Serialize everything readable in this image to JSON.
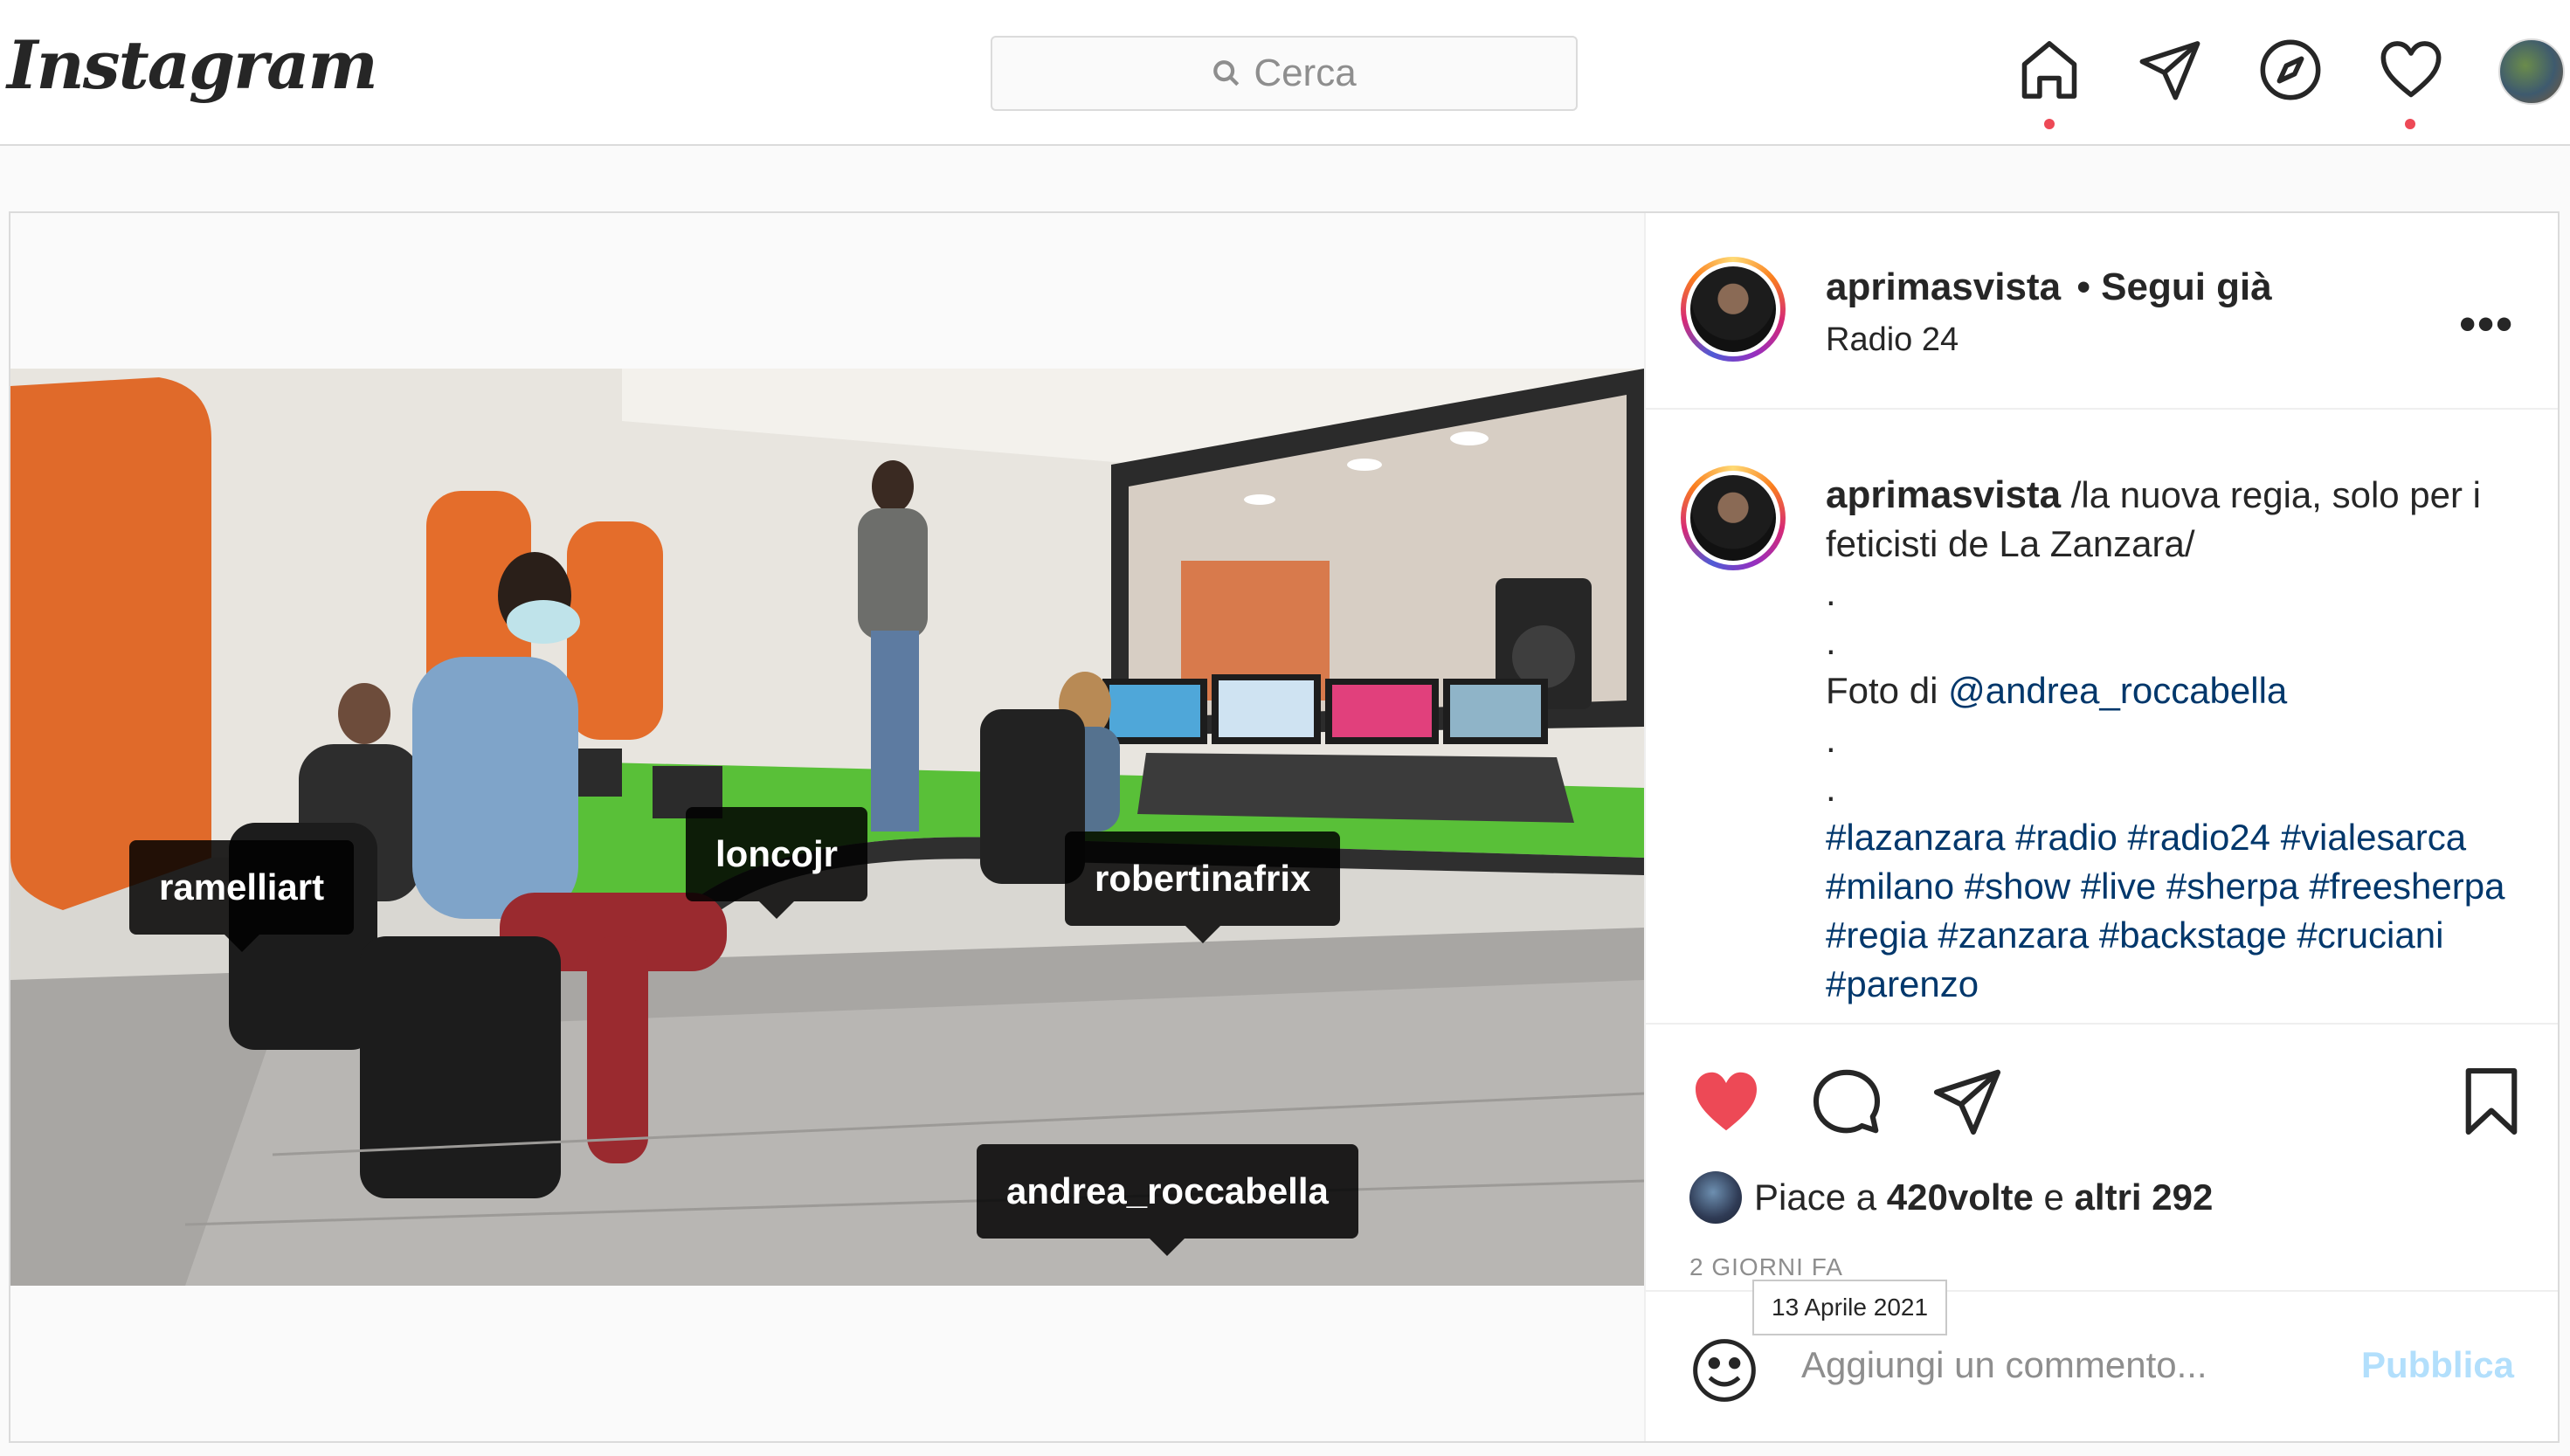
{
  "nav": {
    "logo": "Instagram",
    "search_placeholder": "Cerca",
    "icons": [
      "home-icon",
      "direct-icon",
      "explore-icon",
      "activity-heart-icon",
      "profile-avatar"
    ]
  },
  "post": {
    "author": "aprimasvista",
    "follow_state": "• Segui già",
    "location": "Radio 24",
    "photo_tags": [
      "ramelliart",
      "loncojr",
      "robertinafrix",
      "andrea_roccabella"
    ],
    "caption": {
      "author": "aprimasvista",
      "text": "/la nuova regia, solo per i feticisti de La Zanzara/",
      "dot1": ".",
      "dot2": ".",
      "photo_credit_prefix": "Foto di ",
      "photo_credit_mention": "@andrea_roccabella",
      "dot3": ".",
      "dot4": ".",
      "hashtags": "#lazanzara #radio #radio24 #vialesarca #milano #show #live #sherpa #freesherpa #regia #zanzara #backstage #cruciani #parenzo"
    },
    "likes": {
      "prefix": "Piace a ",
      "user": "420volte",
      "middle": " e ",
      "others": "altri 292"
    },
    "time_ago": "2 GIORNI FA",
    "date_tooltip": "13 Aprile 2021",
    "comment_placeholder": "Aggiungi un commento...",
    "publish_label": "Pubblica"
  },
  "colors": {
    "accent_link": "#00376b",
    "like_red": "#ed4956",
    "publish_disabled": "#b2dffc"
  }
}
